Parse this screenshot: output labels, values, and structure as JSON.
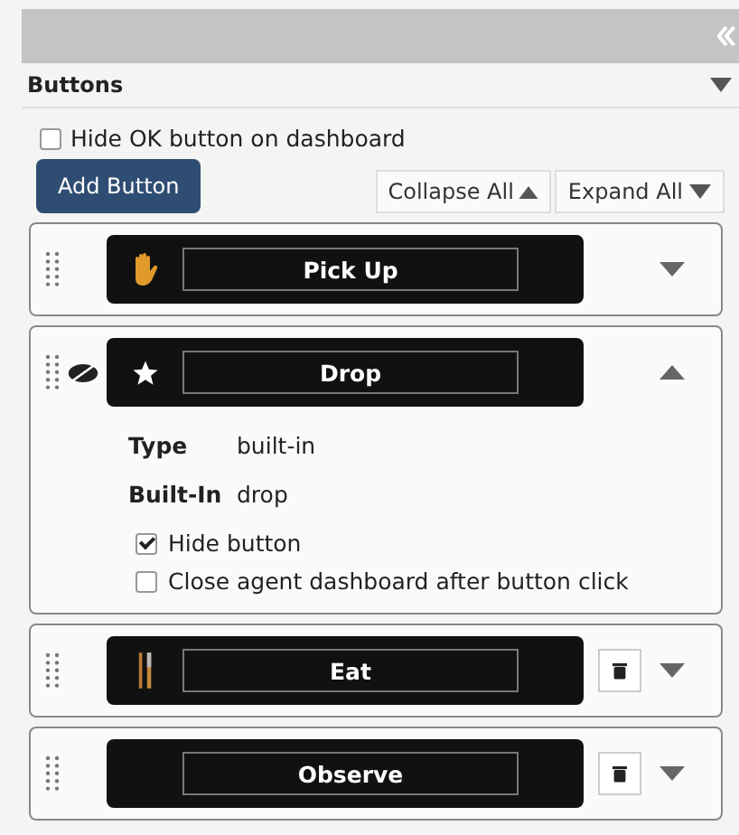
{
  "panel": {
    "title": "Buttons",
    "expanded": true
  },
  "hide_ok": {
    "label": "Hide OK button on dashboard",
    "checked": false
  },
  "add_button": "Add Button",
  "collapse_all": "Collapse All",
  "expand_all": "Expand All",
  "items": [
    {
      "label": "Pick Up",
      "expanded": false,
      "hidden": false,
      "deletable": false
    },
    {
      "label": "Drop",
      "expanded": true,
      "hidden": true,
      "deletable": false,
      "details": [
        {
          "key": "Type",
          "value": "built-in"
        },
        {
          "key": "Built-In",
          "value": "drop"
        }
      ],
      "options": [
        {
          "label": "Hide button",
          "checked": true
        },
        {
          "label": "Close agent dashboard after button click",
          "checked": false
        }
      ]
    },
    {
      "label": "Eat",
      "expanded": false,
      "hidden": false,
      "deletable": true
    },
    {
      "label": "Observe",
      "expanded": false,
      "hidden": false,
      "deletable": true
    }
  ]
}
